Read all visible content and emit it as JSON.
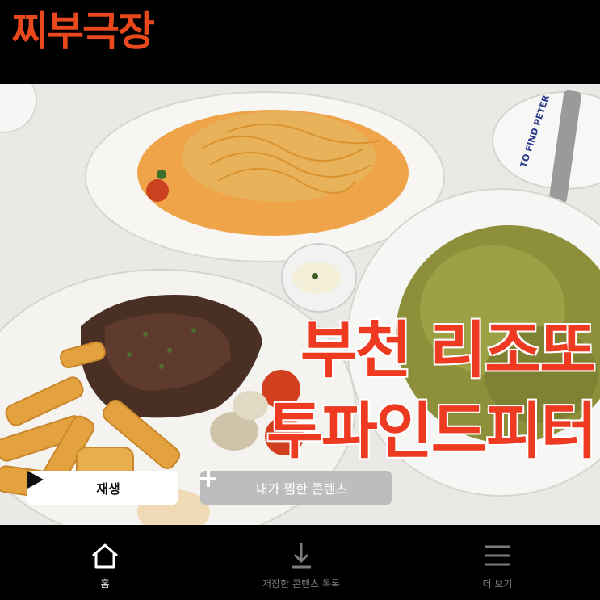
{
  "header": {
    "brand": "찌부극장"
  },
  "hero": {
    "title_line1": "부천 리조또",
    "title_line2": "투파인드피터",
    "plate_text": "TO FIND PETER"
  },
  "actions": {
    "play_label": "재생",
    "add_label": "내가 찜한 콘텐츠"
  },
  "nav": {
    "items": [
      {
        "label": "홈",
        "icon": "home-icon",
        "active": true
      },
      {
        "label": "저장한 콘텐츠 목록",
        "icon": "download-icon",
        "active": false
      },
      {
        "label": "더 보기",
        "icon": "menu-icon",
        "active": false
      }
    ]
  },
  "colors": {
    "brand": "#e8481c",
    "headline": "#ef3a22",
    "background": "#000000"
  }
}
